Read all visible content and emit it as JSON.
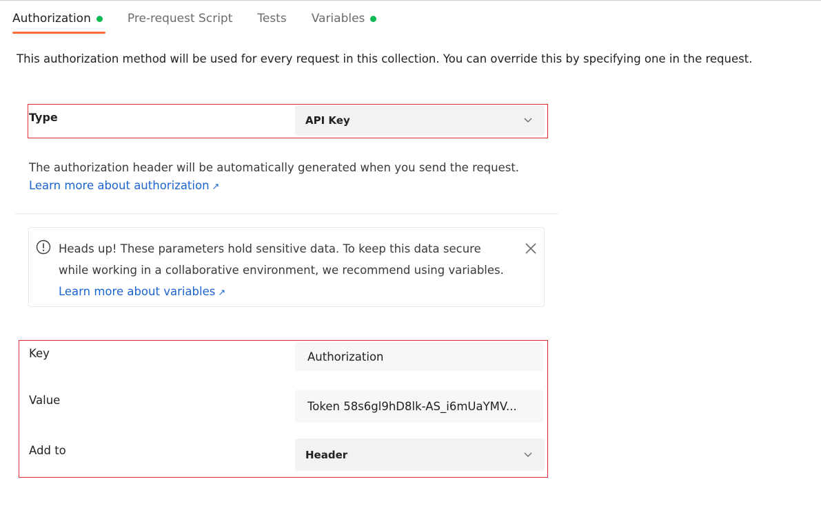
{
  "tabs": [
    {
      "label": "Authorization",
      "dot": true
    },
    {
      "label": "Pre-request Script",
      "dot": false
    },
    {
      "label": "Tests",
      "dot": false
    },
    {
      "label": "Variables",
      "dot": true
    }
  ],
  "description": "This authorization method will be used for every request in this collection. You can override this by specifying one in the request.",
  "auth": {
    "type_label": "Type",
    "type_value": "API Key",
    "info_text": "The authorization header will be automatically generated when you send the request.",
    "info_link": "Learn more about authorization",
    "link_arrow": "↗"
  },
  "alert": {
    "text": "Heads up! These parameters hold sensitive data. To keep this data secure while working in a collaborative environment, we recommend using variables.",
    "link": "Learn more about variables",
    "link_arrow": "↗",
    "icon": "info-circle-icon",
    "close_icon": "close-icon"
  },
  "fields": {
    "key_label": "Key",
    "key_value": "Authorization",
    "value_label": "Value",
    "value_value": "Token 58s6gl9hD8lk-AS_i6mUaYMV...",
    "addto_label": "Add to",
    "addto_value": "Header"
  },
  "colors": {
    "accent": "#ff6c37",
    "status_dot": "#0cbb52",
    "link": "#1c64d0",
    "highlight_box": "#e0282e"
  }
}
